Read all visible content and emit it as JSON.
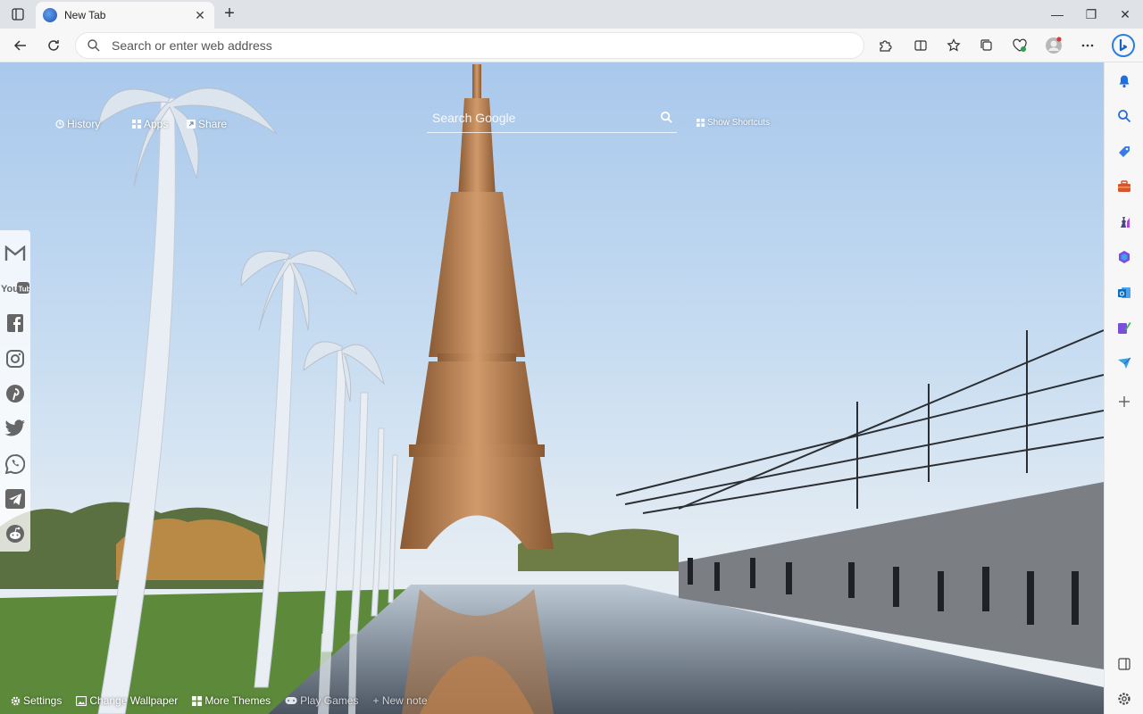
{
  "tab": {
    "title": "New Tab",
    "close": "✕"
  },
  "window": {
    "minimize": "—",
    "maximize": "❐",
    "close": "✕"
  },
  "toolbar": {
    "address_placeholder": "Search or enter web address"
  },
  "newtab": {
    "top_nav": [
      {
        "label": "History",
        "icon": "history-icon"
      },
      {
        "label": "Apps",
        "icon": "apps-icon"
      },
      {
        "label": "Share",
        "icon": "share-icon"
      }
    ],
    "search_placeholder": "Search Google",
    "shortcuts_label": "Show Shortcuts",
    "social_links": [
      "gmail",
      "youtube",
      "facebook",
      "instagram",
      "pinterest",
      "twitter",
      "whatsapp",
      "telegram",
      "reddit"
    ],
    "bottom_bar": {
      "settings": "Settings",
      "change_wallpaper": "Change Wallpaper",
      "more_themes": "More Themes",
      "play_games": "Play Games",
      "new_note": "+ New note"
    }
  },
  "sidebar_icons": [
    "notifications-icon",
    "search-icon",
    "shopping-icon",
    "tools-icon",
    "games-icon",
    "office-icon",
    "outlook-icon",
    "designer-icon",
    "send-icon",
    "add-icon",
    "split-screen-icon",
    "settings-icon"
  ],
  "colors": {
    "accent": "#0f6cbd",
    "titlebar": "#dfe3e8",
    "toolbar": "#f7f7f7"
  }
}
